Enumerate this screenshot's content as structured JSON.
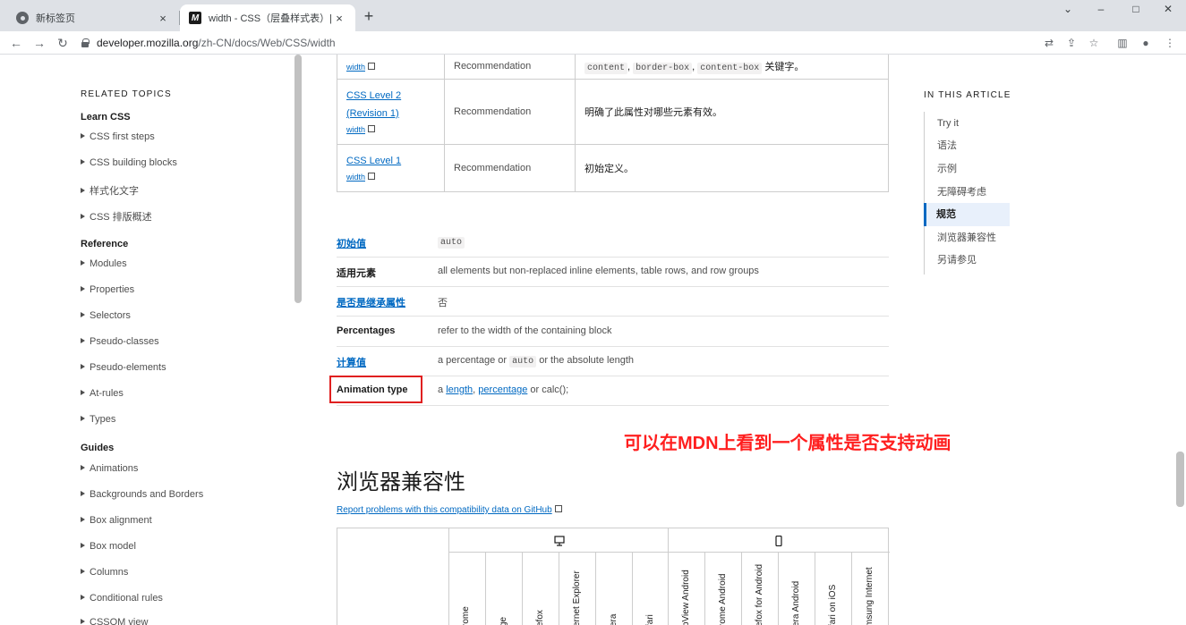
{
  "browser": {
    "tabs": [
      {
        "title": "新标签页",
        "close": "×"
      },
      {
        "title": "width - CSS（层叠样式表）| M",
        "close": "×"
      }
    ],
    "new_tab": "+",
    "window_controls": {
      "minimize": "⌄",
      "restore": "–",
      "maximize": "□",
      "close": "✕"
    },
    "url_host": "developer.mozilla.org",
    "url_path": "/zh-CN/docs/Web/CSS/width",
    "nav": {
      "back": "←",
      "forward": "→",
      "reload": "↻"
    },
    "toolbar_icons": {
      "translate": "⇄",
      "share": "⇪",
      "bookmark": "☆",
      "sidepanel": "▥",
      "profile": "●",
      "menu": "⋮"
    }
  },
  "sidebar": {
    "heading": "RELATED TOPICS",
    "groups": [
      {
        "title": "Learn CSS",
        "items": [
          "CSS first steps",
          "CSS building blocks",
          "样式化文字",
          "CSS 排版概述"
        ]
      },
      {
        "title": "Reference",
        "items": [
          "Modules",
          "Properties",
          "Selectors",
          "Pseudo-classes",
          "Pseudo-elements",
          "At-rules",
          "Types"
        ]
      },
      {
        "title": "Guides",
        "items": [
          "Animations",
          "Backgrounds and Borders",
          "Box alignment",
          "Box model",
          "Columns",
          "Conditional rules",
          "CSSOM view"
        ]
      }
    ]
  },
  "spec_table": [
    {
      "spec": "",
      "sub": "width",
      "status": "Recommendation",
      "comment_codes": [
        "content",
        "border-box",
        "content-box"
      ],
      "comment_suffix": " 关键字。"
    },
    {
      "spec": "CSS Level 2 (Revision 1)",
      "sub": "width",
      "status": "Recommendation",
      "comment": "明确了此属性对哪些元素有效。"
    },
    {
      "spec": "CSS Level 1",
      "sub": "width",
      "status": "Recommendation",
      "comment": "初始定义。"
    }
  ],
  "properties": {
    "initial": {
      "key": "初始值",
      "value_code": "auto"
    },
    "applies": {
      "key": "适用元素",
      "value": "all elements but non-replaced inline elements, table rows, and row groups"
    },
    "inherited": {
      "key": "是否是继承属性",
      "value": "否"
    },
    "percentages": {
      "key": "Percentages",
      "value": "refer to the width of the containing block"
    },
    "computed": {
      "key": "计算值",
      "value_prefix": "a percentage or ",
      "value_code": "auto",
      "value_suffix": " or the absolute length"
    },
    "animation": {
      "key": "Animation type",
      "value_prefix": "a ",
      "link1": "length",
      "sep": ", ",
      "link2": "percentage",
      "value_suffix": " or calc();"
    }
  },
  "annotation": "可以在MDN上看到一个属性是否支持动画",
  "compat": {
    "title": "浏览器兼容性",
    "report_link": "Report problems with this compatibility data on GitHub",
    "desktop_browsers": [
      "rome",
      "ge",
      "efox",
      "ernet Explorer",
      "era",
      "fari"
    ],
    "mobile_browsers": [
      "bView Android",
      "rome Android",
      "efox for Android",
      "era Android",
      "fari on iOS",
      "msung Internet"
    ]
  },
  "toc": {
    "heading": "IN THIS ARTICLE",
    "items": [
      "Try it",
      "语法",
      "示例",
      "无障碍考虑",
      "规范",
      "浏览器兼容性",
      "另请参见"
    ],
    "active_index": 4
  },
  "colors": {
    "link": "#0069c2",
    "annotation": "#ff1f1f",
    "highlight_box": "#e02020"
  }
}
